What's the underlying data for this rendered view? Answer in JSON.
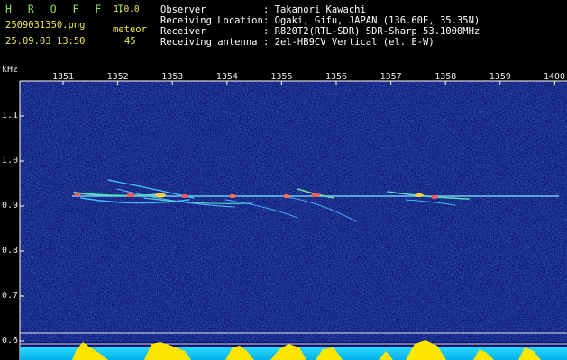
{
  "header": {
    "app_name": "H R O F F T",
    "version": "1.0.0",
    "filename": "2509031350.png",
    "datetime": "25.09.03 13:50",
    "detection_label": "meteor",
    "detection_count": "45",
    "info_labels": [
      "Observer",
      "Receiving Location",
      "Receiver",
      "Receiving antenna"
    ],
    "info_values": [
      ": Takanori Kawachi",
      ": Ogaki, Gifu, JAPAN (136.60E, 35.35N)",
      ": R820T2(RTL-SDR) SDR-Sharp 53.1000MHz",
      ": 2el-HB9CV Vertical (el. E-W)"
    ]
  },
  "axes": {
    "y_unit": "kHz",
    "y_ticks": [
      "1.1",
      "1.0",
      "0.9",
      "0.8",
      "0.7",
      "0.6"
    ],
    "x_ticks": [
      "1351",
      "1352",
      "1353",
      "1354",
      "1355",
      "1356",
      "1357",
      "1358",
      "1359",
      "1400"
    ]
  },
  "colors": {
    "background": "#000000",
    "noise_bg": "#0b1a88",
    "carrier": "#7fd8ff",
    "echo_hot": "#ff5a5a",
    "bottom_band": "#00c8ff",
    "bottom_peaks": "#ffe600",
    "text_yellow": "#f2e84a",
    "logo_green": "#8ee05a"
  }
}
